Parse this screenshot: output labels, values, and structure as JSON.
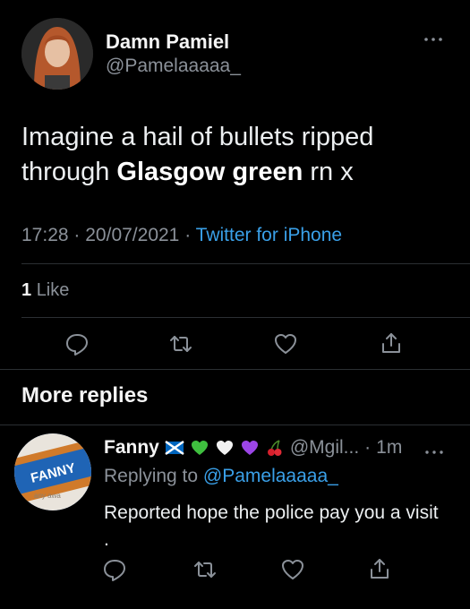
{
  "tweet": {
    "author_name": "Damn Pamiel",
    "author_handle": "@Pamelaaaaa_",
    "text_part1": "Imagine a hail of bullets ripped through ",
    "text_bold": "Glasgow green",
    "text_part2": " rn x",
    "time": "17:28",
    "date": "20/07/2021",
    "separator": "·",
    "source": "Twitter for iPhone",
    "like_count": "1",
    "like_label": "Like"
  },
  "section": {
    "more_replies": "More replies"
  },
  "reply": {
    "author_name": "Fanny",
    "handle": "@Mgil...",
    "dot": "·",
    "age": "1m",
    "replying_prefix": "Replying to ",
    "replying_to": "@Pamelaaaaa_",
    "text": "Reported hope the police pay you a visit .",
    "avatar_text": "FANNY",
    "avatar_subtext": "any awa"
  },
  "icons": {
    "actions": [
      "reply-icon",
      "retweet-icon",
      "like-icon",
      "share-icon"
    ],
    "reply_flags": [
      "scotland-flag-icon",
      "green-heart-icon",
      "white-heart-icon",
      "purple-heart-icon",
      "cherries-icon"
    ]
  },
  "colors": {
    "background": "#000000",
    "link": "#3aa0e8",
    "muted": "#8b9199",
    "divider": "#2b2f33"
  }
}
